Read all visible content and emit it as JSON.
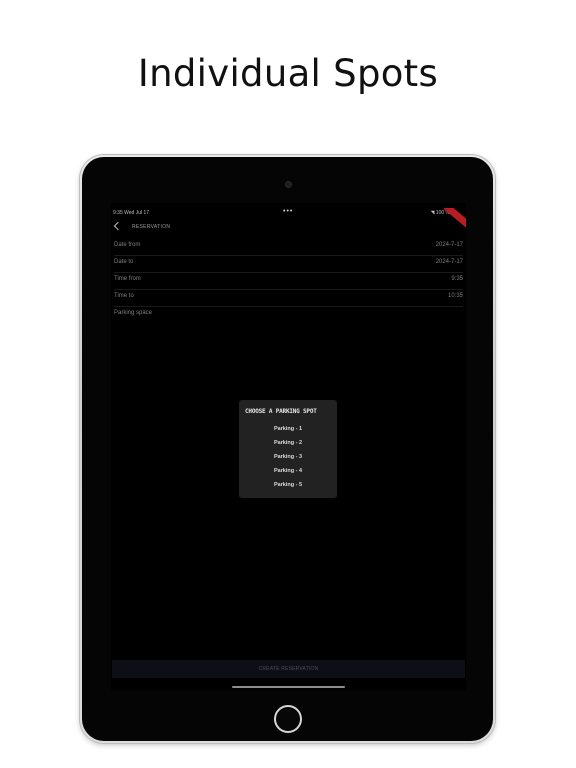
{
  "headline": "Individual Spots",
  "status_bar": {
    "time": "9:35",
    "date": "Wed Jul 17",
    "dots": "•••",
    "battery": "100 %"
  },
  "nav": {
    "title": "RESERVATION"
  },
  "form": {
    "rows": [
      {
        "label": "Date from",
        "value": "2024-7-17"
      },
      {
        "label": "Date to",
        "value": "2024-7-17"
      },
      {
        "label": "Time from",
        "value": "9:35"
      },
      {
        "label": "Time to",
        "value": "10:35"
      },
      {
        "label": "Parking space",
        "value": ""
      }
    ]
  },
  "modal": {
    "title": "CHOOSE A PARKING SPOT",
    "options": [
      "Parking - 1",
      "Parking - 2",
      "Parking - 3",
      "Parking - 4",
      "Parking - 5"
    ]
  },
  "footer": {
    "create_label": "CREATE RESERVATION"
  }
}
